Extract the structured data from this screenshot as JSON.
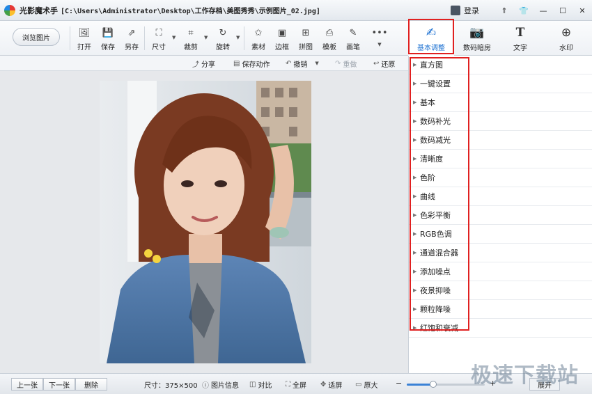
{
  "window": {
    "app_name": "光影魔术手",
    "path": "[C:\\Users\\Administrator\\Desktop\\工作存档\\美图秀秀\\示例图片_02.jpg]",
    "login_label": "登录",
    "controls": [
      "⇑",
      "👕",
      "—",
      "☐",
      "✕"
    ]
  },
  "toolbar": {
    "browse_label": "浏览图片",
    "tools": [
      {
        "name": "open",
        "label": "打开",
        "icon": "image-plus-icon"
      },
      {
        "name": "save",
        "label": "保存",
        "icon": "floppy-icon"
      },
      {
        "name": "save-as",
        "label": "另存",
        "icon": "export-icon"
      },
      {
        "name": "size",
        "label": "尺寸",
        "icon": "resize-icon"
      },
      {
        "name": "crop",
        "label": "裁剪",
        "icon": "crop-icon"
      },
      {
        "name": "rotate",
        "label": "旋转",
        "icon": "rotate-icon"
      },
      {
        "name": "material",
        "label": "素材",
        "icon": "star-frame-icon"
      },
      {
        "name": "border",
        "label": "边框",
        "icon": "frame-icon"
      },
      {
        "name": "collage",
        "label": "拼图",
        "icon": "grid-icon"
      },
      {
        "name": "template",
        "label": "模板",
        "icon": "printer-icon"
      },
      {
        "name": "brush",
        "label": "画笔",
        "icon": "brush-icon"
      },
      {
        "name": "more",
        "label": "",
        "icon": "ellipsis-icon"
      }
    ],
    "tabs": [
      {
        "name": "basic-adjust",
        "label": "基本调整",
        "icon": "edit-square-icon",
        "active": true
      },
      {
        "name": "digital-darkroom",
        "label": "数码暗房",
        "icon": "camera-icon",
        "active": false
      },
      {
        "name": "text",
        "label": "文字",
        "icon": "text-t-icon",
        "active": false
      },
      {
        "name": "watermark",
        "label": "水印",
        "icon": "watermark-plus-icon",
        "active": false
      }
    ]
  },
  "actions": {
    "share": "分享",
    "save_action": "保存动作",
    "undo": "撤销",
    "redo": "重做",
    "restore": "还原"
  },
  "panel": {
    "items": [
      "直方图",
      "一键设置",
      "基本",
      "数码补光",
      "数码减光",
      "清晰度",
      "色阶",
      "曲线",
      "色彩平衡",
      "RGB色调",
      "通道混合器",
      "添加噪点",
      "夜景抑噪",
      "颗粒降噪",
      "红饱和衰减"
    ]
  },
  "statusbar": {
    "prev": "上一张",
    "next": "下一张",
    "delete": "删除",
    "size_text": "尺寸：375×500",
    "info": "图片信息",
    "compare": "对比",
    "fullscreen": "全屏",
    "fit": "适屏",
    "original": "原大",
    "expand": "展开",
    "zoom_fraction": 0.34
  },
  "watermark_text": "极速下载站"
}
